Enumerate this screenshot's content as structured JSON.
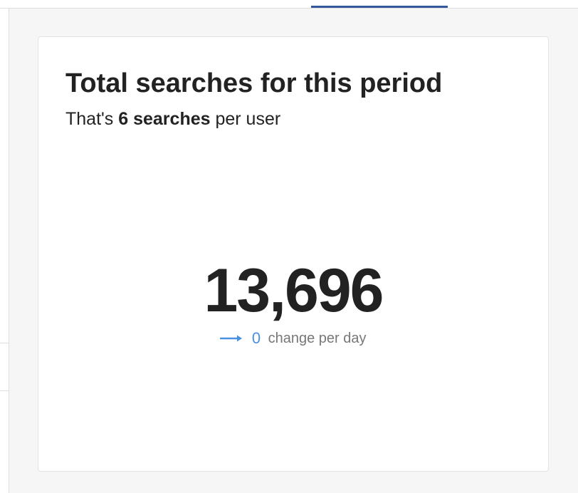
{
  "card": {
    "title": "Total searches for this period",
    "subtitle": {
      "prefix": "That's ",
      "highlight": "6 searches",
      "suffix": " per user"
    },
    "total_value": "13,696",
    "change": {
      "icon": "arrow-right-icon",
      "value": "0",
      "label": "change per day"
    }
  },
  "colors": {
    "accent": "#4a90e2",
    "tab_indicator": "#34589b",
    "text": "#222222",
    "muted_text": "#777777",
    "background": "#f6f6f6"
  }
}
